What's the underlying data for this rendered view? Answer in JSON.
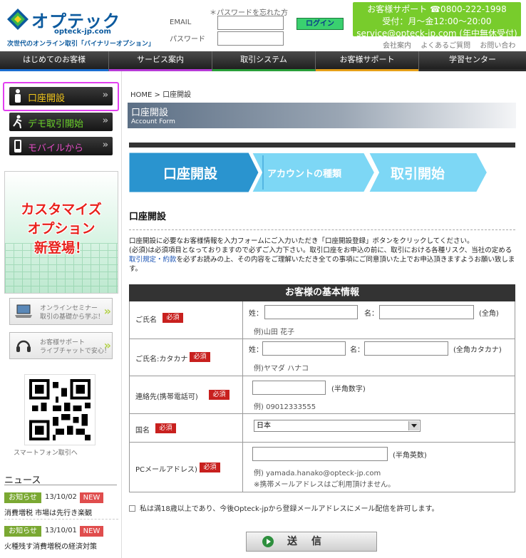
{
  "header": {
    "logo_text": "オプテック",
    "logo_domain": "opteck-jp.com",
    "tagline": "次世代のオンライン取引「バイナリーオプション」",
    "forgot_password": "＊パスワードを忘れた方",
    "email_label": "EMAIL",
    "password_label": "パスワード",
    "login_button": "ログイン",
    "support": {
      "line1": "お客様サポート ☎0800-222-1998",
      "line2": "受付：月～金12:00～20:00",
      "line3": "service@opteck-jp.com (年中無休受付)"
    },
    "links": [
      "会社案内",
      "よくあるご質問",
      "お問い合わせ"
    ]
  },
  "nav": [
    "はじめてのお客様",
    "サービス案内",
    "取引システム",
    "お客様サポート",
    "学習センター"
  ],
  "sidebar": {
    "buttons": [
      "口座開設",
      "デモ取引開始",
      "モバイルから"
    ],
    "banner_lines": [
      "カスタマイズ",
      "オプション",
      "新登場！"
    ],
    "seminar": {
      "line1": "オンラインセミナー",
      "line2": "取引の基礎から学ぶ！"
    },
    "chat": {
      "line1": "お客様サポート",
      "line2": "ライブチャットで安心！"
    },
    "qr_caption": "スマートフォン取引へ",
    "news_title": "ニュース",
    "news": [
      {
        "badge": "お知らせ",
        "date": "13/10/02",
        "new": "NEW",
        "title": "消費増税 市場は先行き楽観"
      },
      {
        "badge": "お知らせ",
        "date": "13/10/01",
        "new": "NEW",
        "title": "火種残す消費増税の経済対策"
      }
    ]
  },
  "main": {
    "breadcrumb": "HOME > 口座開設",
    "page_title": "口座開設",
    "page_subtitle": "Account Form",
    "steps": [
      "口座開設",
      "アカウントの種類",
      "取引開始"
    ],
    "section_title": "口座開設",
    "intro_1": "口座開設に必要なお客様情報を入力フォームにご入力いただき「口座開設登録」ボタンをクリックしてください。",
    "intro_2": "(必須)は必須項目となっておりますので必ずご入力下さい。取引口座をお申込の前に、取引における各種リスク、当社の定める",
    "intro_link": "取引規定・約款",
    "intro_3": "を必ずお読みの上、その内容をご理解いただき全ての事項にご同意頂いた上でお申込頂きますようお願い致します。",
    "form": {
      "heading": "お客様の基本情報",
      "required": "必須",
      "name_label": "ご氏名",
      "kana_label": "ご氏名:カタカナ",
      "phone_label": "連絡先(携帯電話可)",
      "country_label": "国名",
      "email_label": "PCメールアドレス)",
      "sei": "姓：",
      "mei": "名：",
      "zenkaku": "(全角)",
      "zenkaku_kana": "(全角カタカナ)",
      "hankaku_num": "(半角数字)",
      "hankaku_alnum": "(半角英数)",
      "name_example": "例)山田 花子",
      "kana_example": "例)ヤマダ ハナコ",
      "phone_example": "例) 09012333555",
      "country_value": "日本",
      "email_example": "例) yamada.hanako@opteck-jp.com",
      "email_note": "※携帯メールアドレスはご利用頂けません。"
    },
    "agree_text": "私は満18歳以上であり、今後Opteck-jpから登録メールアドレスにメール配信を許可します。",
    "submit_label": "送信"
  },
  "colors": {
    "brand_blue": "#0c5a9e",
    "support_green": "#78cc2c",
    "required_red": "#c8201e",
    "step_active": "#2a94cf",
    "step_inactive": "#7dd7f5",
    "highlight_magenta": "#e23ff0"
  }
}
